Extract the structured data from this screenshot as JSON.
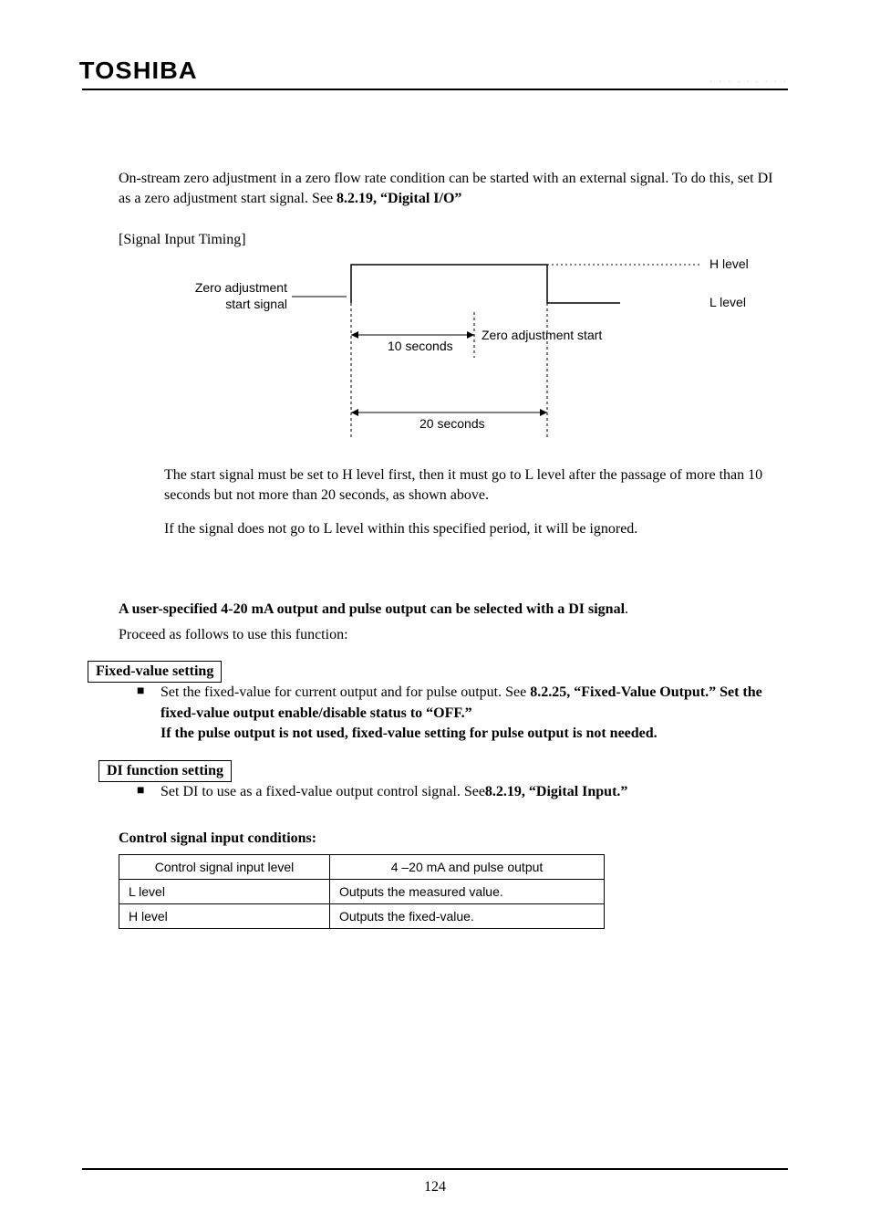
{
  "header": {
    "logo": "TOSHIBA",
    "right": ". . . . . . . . ."
  },
  "intro": "On-stream zero adjustment in a zero flow rate condition can be started with an external signal. To do this, set DI as a zero adjustment start signal. See ",
  "intro_ref": "8.2.19, “Digital I/O”",
  "timing": {
    "title": "[Signal Input Timing]",
    "signal_label_a": "Zero adjustment",
    "signal_label_b": "start signal",
    "h_level": "H level",
    "l_level": "L level",
    "ten_sec": "10 seconds",
    "twenty_sec": "20 seconds",
    "start_label": "Zero adjustment start"
  },
  "note1": "The start signal must be set to H level first, then it must go to L level after the passage of more than 10 seconds but not more than 20 seconds, as shown above.",
  "note2": "If the signal does not go to L level within this specified period, it will be ignored.",
  "user_spec_line_bold": "A user-specified 4-20 mA output and pulse output can be selected with a DI signal",
  "user_spec_line_tail": ".",
  "proceed": "Proceed as follows to use this function:",
  "fixed_value": {
    "box": "Fixed-value setting",
    "line1_a": "Set the fixed-value for current output and for pulse output. See ",
    "line1_b": "8.2.25, “Fixed-Value Output.” Set the fixed-value output enable/disable status to “OFF.”",
    "line2": " If the pulse output is not used, fixed-value setting for pulse output is not needed."
  },
  "di_func": {
    "box": "DI function setting",
    "line_a": "Set DI to use as a fixed-value output control signal. See",
    "line_b": "8.2.19, “Digital Input.”"
  },
  "table": {
    "title": "Control signal input conditions:",
    "headers": [
      "Control signal input level",
      "4 –20 mA and pulse output"
    ],
    "rows": [
      [
        "L level",
        "Outputs the measured value."
      ],
      [
        "H level",
        "Outputs the fixed-value."
      ]
    ]
  },
  "page_number": "124"
}
